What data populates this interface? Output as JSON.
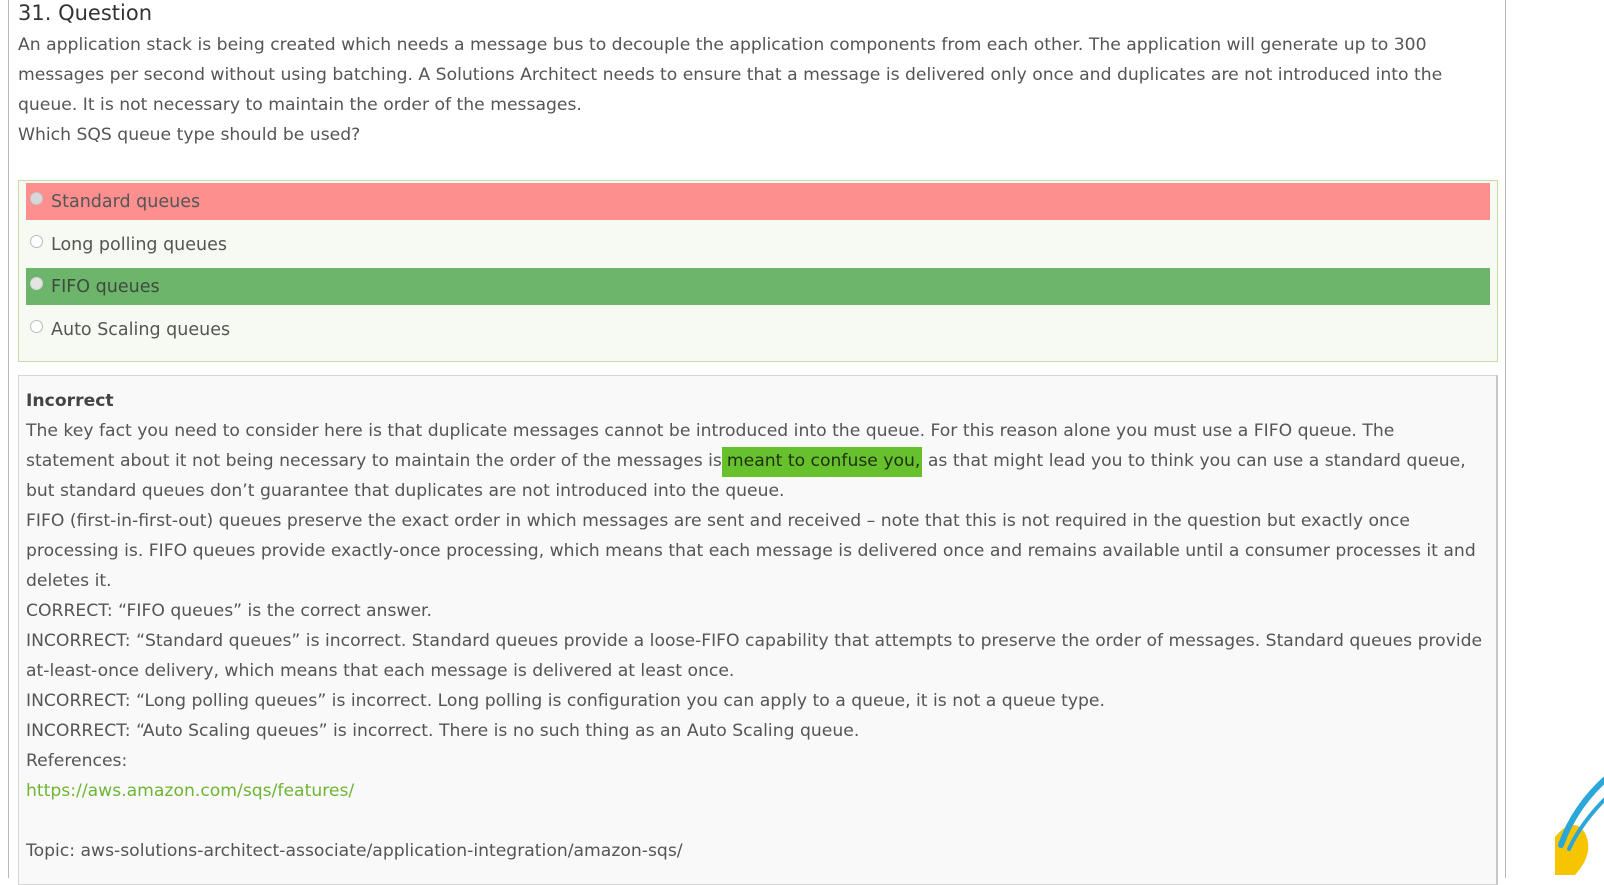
{
  "question": {
    "title": "31. Question",
    "paragraph": "An application stack is being created which needs a message bus to decouple the application components from each other. The application will generate up to 300 messages per second without using batching. A Solutions Architect needs to ensure that a message is delivered only once and duplicates are not introduced into the queue. It is not necessary to maintain the order of the messages.",
    "prompt": "Which SQS queue type should be used?"
  },
  "answers": [
    {
      "label": "Standard queues",
      "state": "selected-incorrect",
      "color": "#fd8f8e"
    },
    {
      "label": "Long polling queues",
      "state": "none"
    },
    {
      "label": "FIFO queues",
      "state": "correct",
      "color": "#6db56b"
    },
    {
      "label": "Auto Scaling queues",
      "state": "none"
    }
  ],
  "explanation": {
    "verdict": "Incorrect",
    "p1_before": "The key fact you need to consider here is that duplicate messages cannot be introduced into the queue. For this reason alone you must use a FIFO queue. The statement about it not being necessary to maintain the order of the messages is",
    "p1_highlight": "meant to confuse you,",
    "p1_after": " as that might lead you to think you can use a standard queue, but standard queues don’t guarantee that duplicates are not introduced into the queue.",
    "highlight_color": "#66c12c",
    "p2": "FIFO (first-in-first-out) queues preserve the exact order in which messages are sent and received – note that this is not required in the question but exactly once processing is. FIFO queues provide exactly-once processing, which means that each message is delivered once and remains available until a consumer processes it and deletes it.",
    "p3": "CORRECT: “FIFO queues” is the correct answer.",
    "p4": "INCORRECT: “Standard queues” is incorrect. Standard queues provide a loose-FIFO capability that attempts to preserve the order of messages. Standard queues provide at-least-once delivery, which means that each message is delivered at least once.",
    "p5": "INCORRECT: “Long polling queues” is incorrect. Long polling is configuration you can apply to a queue, it is not a queue type.",
    "p6": "INCORRECT: “Auto Scaling queues” is incorrect. There is no such thing as an Auto Scaling queue.",
    "references_label": "References:",
    "reference_url": "https://aws.amazon.com/sqs/features/",
    "link_color": "#6eb534",
    "topic": "Topic: aws-solutions-architect-associate/application-integration/amazon-sqs/"
  }
}
